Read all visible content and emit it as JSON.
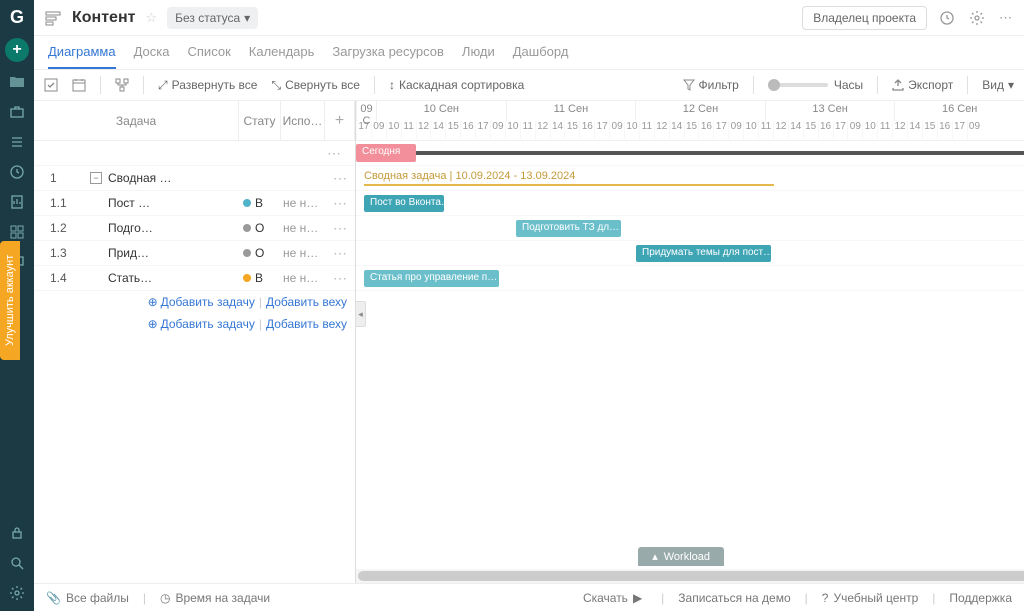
{
  "header": {
    "title": "Контент",
    "status_label": "Без статуса",
    "owner_label": "Владелец проекта"
  },
  "upgrade": {
    "label": "Улучшить аккаунт"
  },
  "tabs": {
    "diagram": "Диаграмма",
    "board": "Доска",
    "list": "Список",
    "calendar": "Календарь",
    "workload": "Загрузка ресурсов",
    "people": "Люди",
    "dashboard": "Дашборд"
  },
  "toolbar": {
    "expand_all": "Развернуть все",
    "collapse_all": "Свернуть все",
    "cascade_sort": "Каскадная сортировка",
    "filter": "Фильтр",
    "hours": "Часы",
    "export": "Экспорт",
    "view": "Вид"
  },
  "grid": {
    "headers": {
      "task": "Задача",
      "status": "Стату",
      "assignee": "Испо…"
    },
    "rows": [
      {
        "wbs": "1",
        "name": "Сводная …",
        "status_text": "",
        "status_color": "",
        "assignee": "",
        "is_summary": true
      },
      {
        "wbs": "1.1",
        "name": "Пост …",
        "status_text": "В",
        "status_color": "#4fb3c9",
        "assignee": "не н…"
      },
      {
        "wbs": "1.2",
        "name": "Подго…",
        "status_text": "О",
        "status_color": "#9a9a9a",
        "assignee": "не н…"
      },
      {
        "wbs": "1.3",
        "name": "Прид…",
        "status_text": "О",
        "status_color": "#9a9a9a",
        "assignee": "не н…"
      },
      {
        "wbs": "1.4",
        "name": "Стать…",
        "status_text": "В",
        "status_color": "#f5a623",
        "assignee": "не н…"
      }
    ],
    "add_task": "Добавить задачу",
    "add_milestone": "Добавить веху"
  },
  "gantt": {
    "days": [
      "09 С",
      "10 Сен",
      "11 Сен",
      "12 Сен",
      "13 Сен",
      "16 Сен"
    ],
    "hours": [
      "17",
      "09",
      "10",
      "11",
      "12",
      "14",
      "15",
      "16",
      "17",
      "09",
      "10",
      "11",
      "12",
      "14",
      "15",
      "16",
      "17",
      "09",
      "10",
      "11",
      "12",
      "14",
      "15",
      "16",
      "17",
      "09",
      "10",
      "11",
      "12",
      "14",
      "15",
      "16",
      "17",
      "09",
      "10",
      "11",
      "12",
      "14",
      "15",
      "16",
      "17",
      "09"
    ],
    "today_label": "Сегодня",
    "summary_title": "Сводная задача",
    "summary_dates": "10.09.2024 - 13.09.2024",
    "tasks": {
      "t1": "Пост во Вконта…",
      "t2": "Подготовить ТЗ дл…",
      "t3": "Придумать темы для пост…",
      "t4": "Статья про управление п…"
    },
    "workload_label": "Workload"
  },
  "statusbar": {
    "all_files": "Все файлы",
    "time_on_tasks": "Время на задачи",
    "download": "Скачать",
    "book_demo": "Записаться на демо",
    "help_center": "Учебный центр",
    "support": "Поддержка"
  }
}
